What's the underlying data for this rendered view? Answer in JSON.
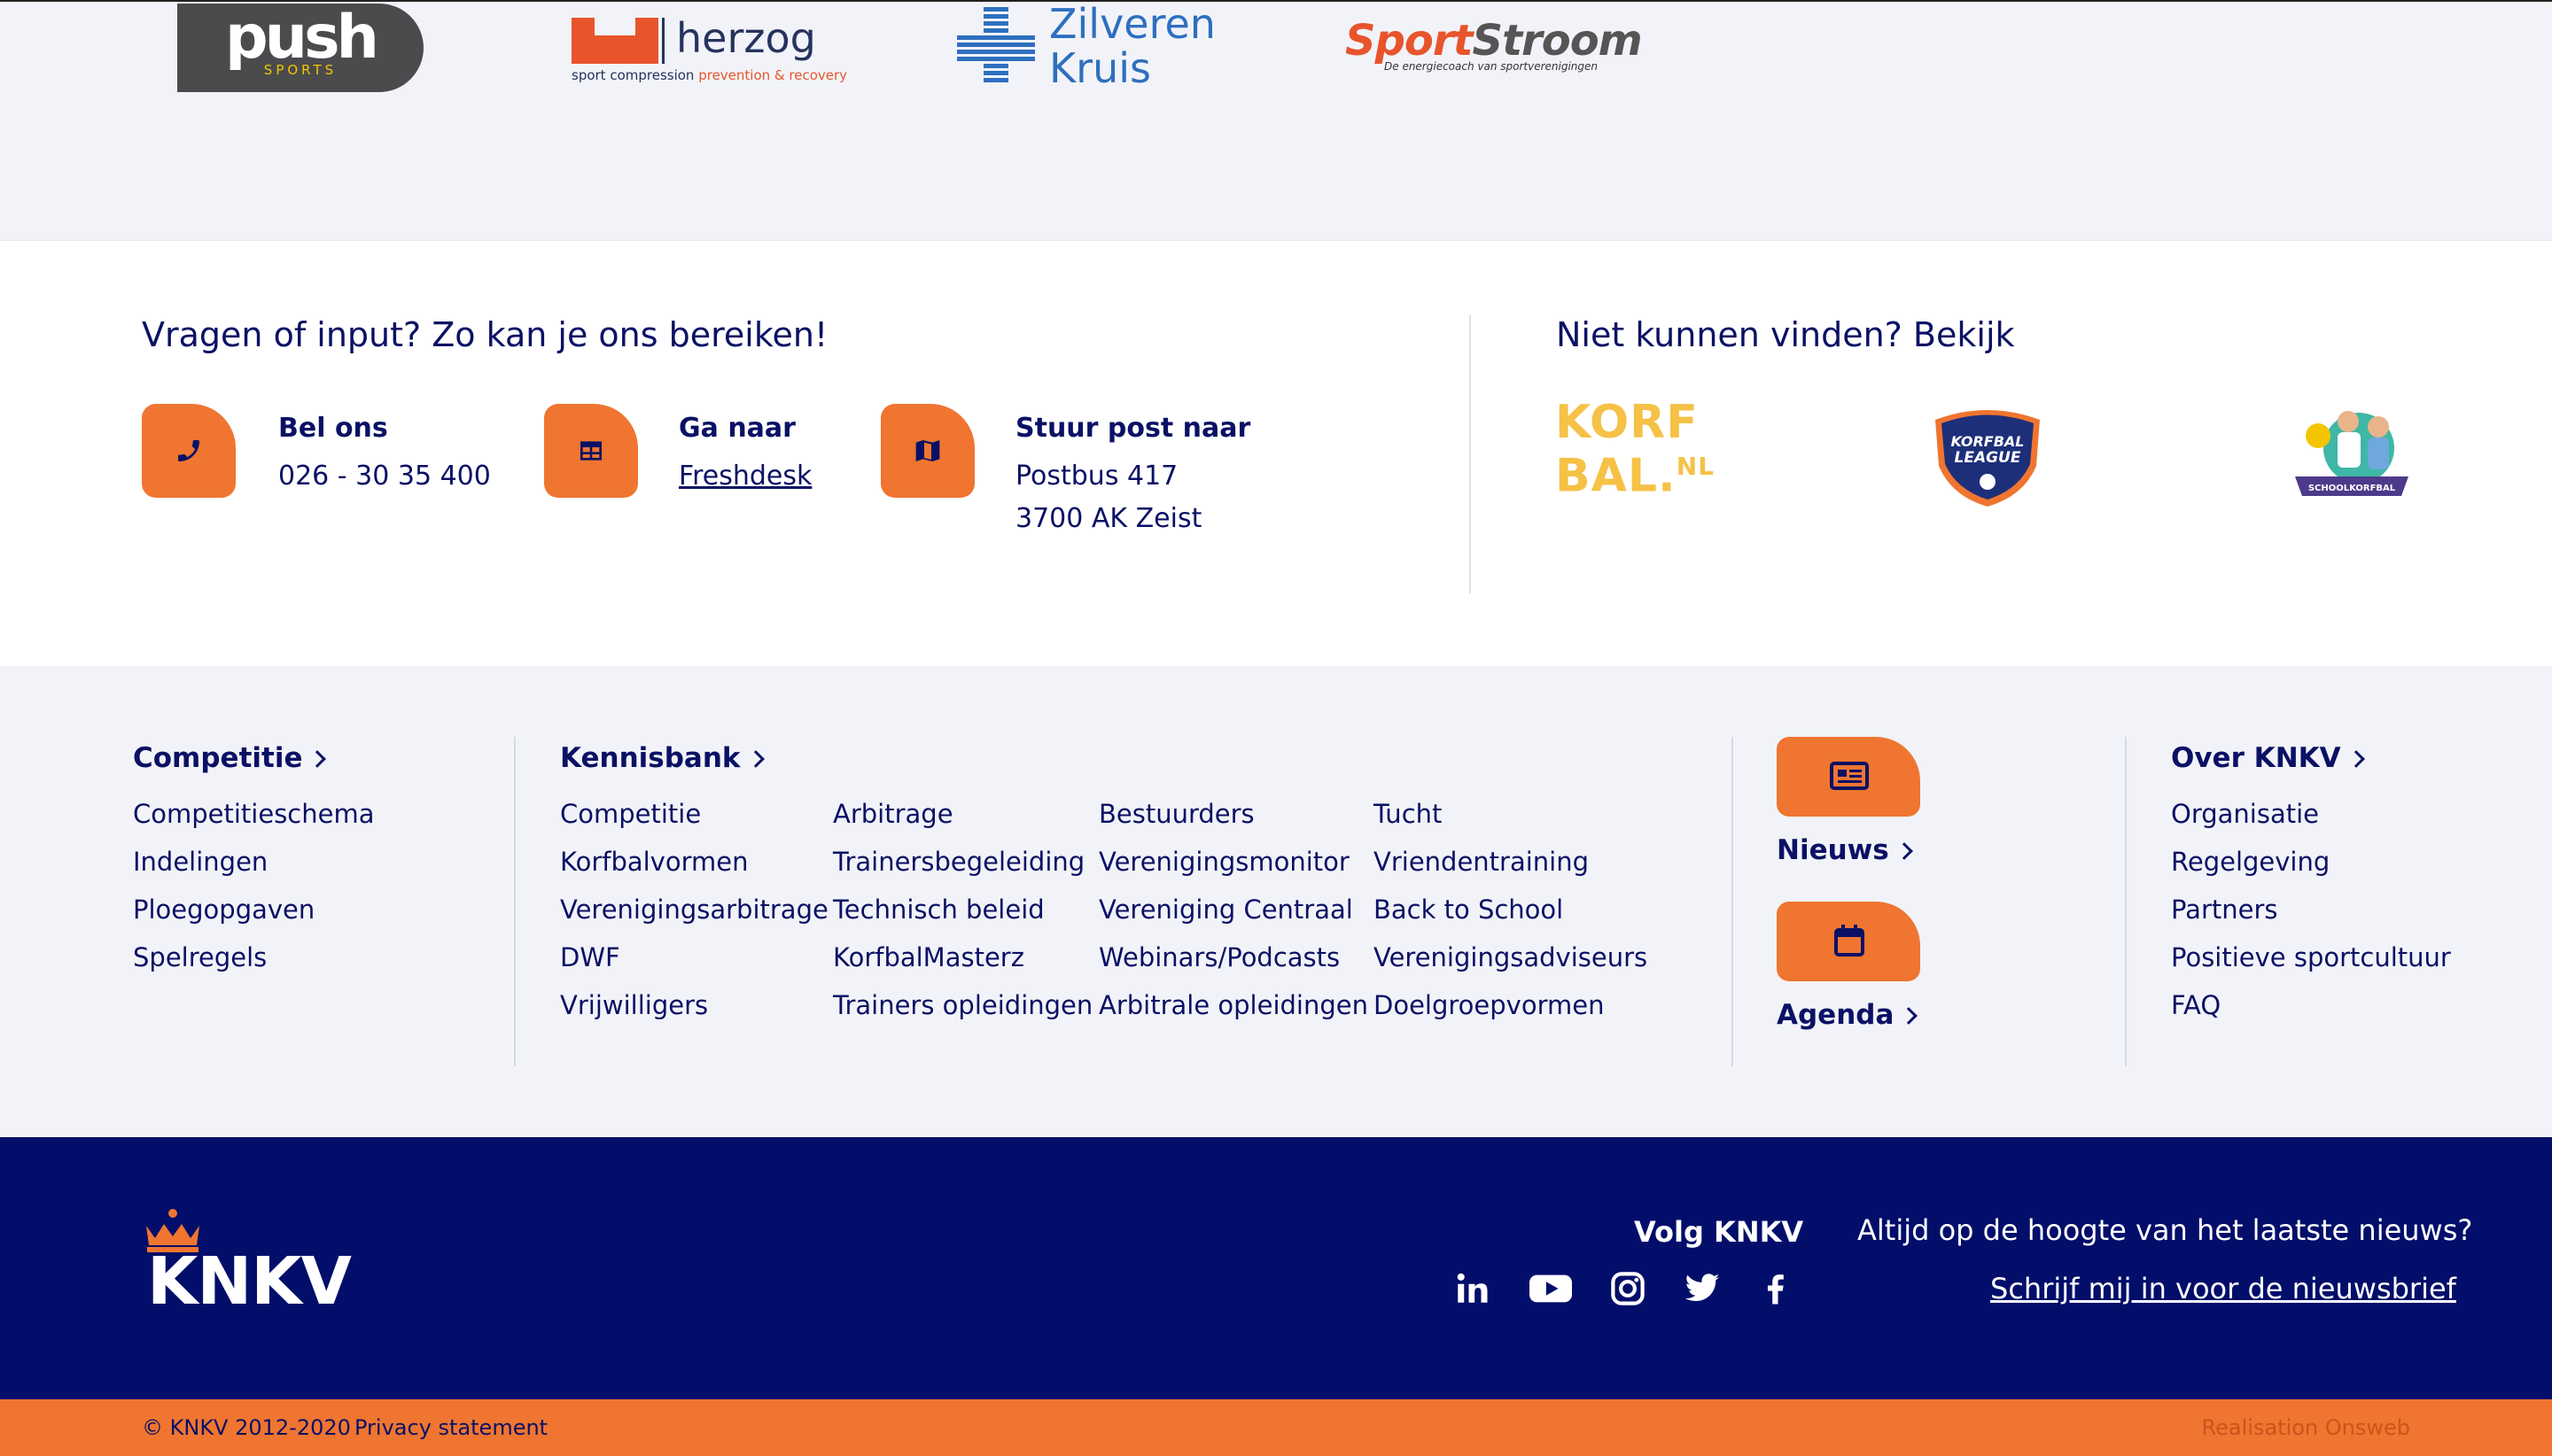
{
  "sponsors": {
    "push": {
      "name": "push",
      "sub": "SPORTS"
    },
    "herzog": {
      "name": "herzog",
      "sub_a": "sport compression",
      "sub_b": "prevention & recovery"
    },
    "zilveren": {
      "line1": "Zilveren",
      "line2": "Kruis"
    },
    "sportstroom": {
      "name_a": "Sport",
      "name_b": "Stroom",
      "tagline": "De energiecoach van sportverenigingen"
    }
  },
  "contact": {
    "heading": "Vragen of input? Zo kan je ons bereiken!",
    "items": [
      {
        "icon": "phone-icon",
        "title": "Bel ons",
        "line1": "026 - 30 35 400"
      },
      {
        "icon": "window-icon",
        "title": "Ga naar",
        "link": "Freshdesk"
      },
      {
        "icon": "map-icon",
        "title": "Stuur post naar",
        "line1": "Postbus 417",
        "line2": "3700 AK Zeist"
      }
    ],
    "find_heading": "Niet kunnen vinden? Bekijk",
    "korfbal_logo": {
      "line1": "KORF",
      "line2": "BAL.",
      "suffix": "NL"
    },
    "league_logo": {
      "line1": "KORFBAL",
      "line2": "LEAGUE"
    },
    "school_logo": {
      "text": "SCHOOLKORFBAL"
    }
  },
  "footer_nav": {
    "competitie": {
      "title": "Competitie",
      "links": [
        "Competitieschema",
        "Indelingen",
        "Ploegopgaven",
        "Spelregels"
      ]
    },
    "kennisbank": {
      "title": "Kennisbank",
      "col1": [
        "Competitie",
        "Korfbalvormen",
        "Verenigingsarbitrage",
        "DWF",
        "Vrijwilligers"
      ],
      "col2": [
        "Arbitrage",
        "Trainersbegeleiding",
        "Technisch beleid",
        "KorfbalMasterz",
        "Trainers opleidingen"
      ],
      "col3": [
        "Bestuurders",
        "Verenigingsmonitor",
        "Vereniging Centraal",
        "Webinars/Podcasts",
        "Arbitrale opleidingen"
      ],
      "col4": [
        "Tucht",
        "Vriendentraining",
        "Back to School",
        "Verenigingsadviseurs",
        "Doelgroepvormen"
      ]
    },
    "nieuws": {
      "title": "Nieuws",
      "icon": "newspaper-icon"
    },
    "agenda": {
      "title": "Agenda",
      "icon": "calendar-icon"
    },
    "over": {
      "title": "Over KNKV",
      "links": [
        "Organisatie",
        "Regelgeving",
        "Partners",
        "Positieve sportcultuur",
        "FAQ"
      ]
    }
  },
  "footer": {
    "logo_text": "KNKV",
    "volg": "Volg KNKV",
    "social": [
      "linkedin-icon",
      "youtube-icon",
      "instagram-icon",
      "twitter-icon",
      "facebook-icon"
    ],
    "newsletter_prompt": "Altijd op de hoogte van het laatste nieuws?",
    "newsletter_link": "Schrijf mij in voor de nieuwsbrief"
  },
  "bottom_bar": {
    "copyright": "© KNKV 2012-2020",
    "privacy": "Privacy statement",
    "realisation": "Realisation Onsweb"
  },
  "colors": {
    "navy": "#020e6a",
    "orange": "#ef7530",
    "light_bg": "#f2f3f8"
  }
}
